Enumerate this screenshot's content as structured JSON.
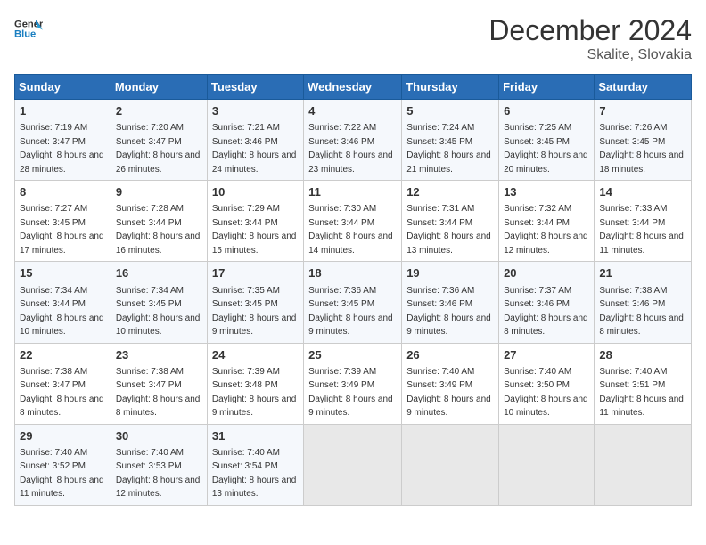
{
  "header": {
    "logo_line1": "General",
    "logo_line2": "Blue",
    "title": "December 2024",
    "subtitle": "Skalite, Slovakia"
  },
  "weekdays": [
    "Sunday",
    "Monday",
    "Tuesday",
    "Wednesday",
    "Thursday",
    "Friday",
    "Saturday"
  ],
  "weeks": [
    [
      {
        "day": "1",
        "sunrise": "7:19 AM",
        "sunset": "3:47 PM",
        "daylight": "8 hours and 28 minutes."
      },
      {
        "day": "2",
        "sunrise": "7:20 AM",
        "sunset": "3:47 PM",
        "daylight": "8 hours and 26 minutes."
      },
      {
        "day": "3",
        "sunrise": "7:21 AM",
        "sunset": "3:46 PM",
        "daylight": "8 hours and 24 minutes."
      },
      {
        "day": "4",
        "sunrise": "7:22 AM",
        "sunset": "3:46 PM",
        "daylight": "8 hours and 23 minutes."
      },
      {
        "day": "5",
        "sunrise": "7:24 AM",
        "sunset": "3:45 PM",
        "daylight": "8 hours and 21 minutes."
      },
      {
        "day": "6",
        "sunrise": "7:25 AM",
        "sunset": "3:45 PM",
        "daylight": "8 hours and 20 minutes."
      },
      {
        "day": "7",
        "sunrise": "7:26 AM",
        "sunset": "3:45 PM",
        "daylight": "8 hours and 18 minutes."
      }
    ],
    [
      {
        "day": "8",
        "sunrise": "7:27 AM",
        "sunset": "3:45 PM",
        "daylight": "8 hours and 17 minutes."
      },
      {
        "day": "9",
        "sunrise": "7:28 AM",
        "sunset": "3:44 PM",
        "daylight": "8 hours and 16 minutes."
      },
      {
        "day": "10",
        "sunrise": "7:29 AM",
        "sunset": "3:44 PM",
        "daylight": "8 hours and 15 minutes."
      },
      {
        "day": "11",
        "sunrise": "7:30 AM",
        "sunset": "3:44 PM",
        "daylight": "8 hours and 14 minutes."
      },
      {
        "day": "12",
        "sunrise": "7:31 AM",
        "sunset": "3:44 PM",
        "daylight": "8 hours and 13 minutes."
      },
      {
        "day": "13",
        "sunrise": "7:32 AM",
        "sunset": "3:44 PM",
        "daylight": "8 hours and 12 minutes."
      },
      {
        "day": "14",
        "sunrise": "7:33 AM",
        "sunset": "3:44 PM",
        "daylight": "8 hours and 11 minutes."
      }
    ],
    [
      {
        "day": "15",
        "sunrise": "7:34 AM",
        "sunset": "3:44 PM",
        "daylight": "8 hours and 10 minutes."
      },
      {
        "day": "16",
        "sunrise": "7:34 AM",
        "sunset": "3:45 PM",
        "daylight": "8 hours and 10 minutes."
      },
      {
        "day": "17",
        "sunrise": "7:35 AM",
        "sunset": "3:45 PM",
        "daylight": "8 hours and 9 minutes."
      },
      {
        "day": "18",
        "sunrise": "7:36 AM",
        "sunset": "3:45 PM",
        "daylight": "8 hours and 9 minutes."
      },
      {
        "day": "19",
        "sunrise": "7:36 AM",
        "sunset": "3:46 PM",
        "daylight": "8 hours and 9 minutes."
      },
      {
        "day": "20",
        "sunrise": "7:37 AM",
        "sunset": "3:46 PM",
        "daylight": "8 hours and 8 minutes."
      },
      {
        "day": "21",
        "sunrise": "7:38 AM",
        "sunset": "3:46 PM",
        "daylight": "8 hours and 8 minutes."
      }
    ],
    [
      {
        "day": "22",
        "sunrise": "7:38 AM",
        "sunset": "3:47 PM",
        "daylight": "8 hours and 8 minutes."
      },
      {
        "day": "23",
        "sunrise": "7:38 AM",
        "sunset": "3:47 PM",
        "daylight": "8 hours and 8 minutes."
      },
      {
        "day": "24",
        "sunrise": "7:39 AM",
        "sunset": "3:48 PM",
        "daylight": "8 hours and 9 minutes."
      },
      {
        "day": "25",
        "sunrise": "7:39 AM",
        "sunset": "3:49 PM",
        "daylight": "8 hours and 9 minutes."
      },
      {
        "day": "26",
        "sunrise": "7:40 AM",
        "sunset": "3:49 PM",
        "daylight": "8 hours and 9 minutes."
      },
      {
        "day": "27",
        "sunrise": "7:40 AM",
        "sunset": "3:50 PM",
        "daylight": "8 hours and 10 minutes."
      },
      {
        "day": "28",
        "sunrise": "7:40 AM",
        "sunset": "3:51 PM",
        "daylight": "8 hours and 11 minutes."
      }
    ],
    [
      {
        "day": "29",
        "sunrise": "7:40 AM",
        "sunset": "3:52 PM",
        "daylight": "8 hours and 11 minutes."
      },
      {
        "day": "30",
        "sunrise": "7:40 AM",
        "sunset": "3:53 PM",
        "daylight": "8 hours and 12 minutes."
      },
      {
        "day": "31",
        "sunrise": "7:40 AM",
        "sunset": "3:54 PM",
        "daylight": "8 hours and 13 minutes."
      },
      null,
      null,
      null,
      null
    ]
  ],
  "labels": {
    "sunrise": "Sunrise:",
    "sunset": "Sunset:",
    "daylight": "Daylight:"
  }
}
